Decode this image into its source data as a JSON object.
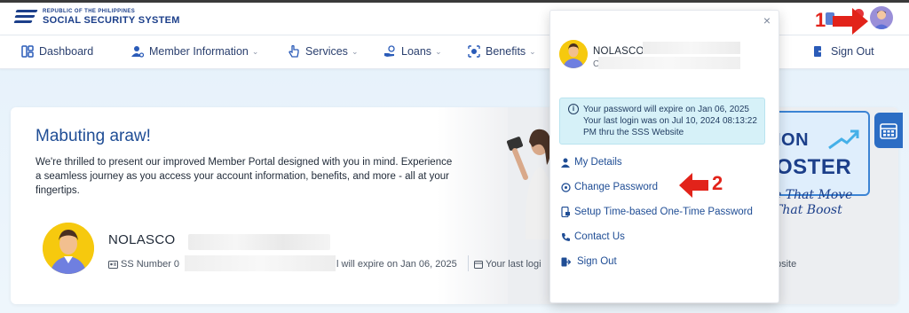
{
  "header": {
    "logo_small": "REPUBLIC OF THE PHILIPPINES",
    "logo_big": "SOCIAL SECURITY SYSTEM"
  },
  "nav": {
    "dashboard": "Dashboard",
    "member_info": "Member Information",
    "services": "Services",
    "loans": "Loans",
    "benefits": "Benefits",
    "sign_out": "Sign Out"
  },
  "welcome": {
    "greeting": "Mabuting araw!",
    "intro": "We're thrilled to present our improved Member Portal designed with you in mind. Experience a seamless journey as you access your account information, benefits, and more - all at your fingertips.",
    "member_name": "NOLASCO",
    "ss_label": "SS Number 0",
    "expire_text": "l will expire on Jan 06, 2025",
    "last_login_label": "Your last logi",
    "website_text": "bsite"
  },
  "promo": {
    "line1": "ION",
    "line2": "OSTER",
    "script_line1": "e That Move",
    "script_line2": "That Boost"
  },
  "dropdown": {
    "name": "NOLASCO",
    "sub_initial": "C",
    "info_line1": "Your password will expire on Jan 06, 2025",
    "info_line2": "Your last login was on Jul 10, 2024 08:13:22 PM thru the SSS Website",
    "menu": [
      {
        "label": "My Details",
        "icon": "user-icon"
      },
      {
        "label": "Change Password",
        "icon": "key-icon"
      },
      {
        "label": "Setup Time-based One-Time Password",
        "icon": "phone-lock-icon"
      },
      {
        "label": "Contact Us",
        "icon": "phone-icon"
      },
      {
        "label": "Sign Out",
        "icon": "sign-out-icon"
      }
    ]
  },
  "annotations": {
    "one": "1",
    "two": "2"
  },
  "colors": {
    "brand": "#1c3f8a",
    "link": "#1f4d95",
    "info_bg": "#d6f1f8",
    "annotation_red": "#e2231a"
  }
}
